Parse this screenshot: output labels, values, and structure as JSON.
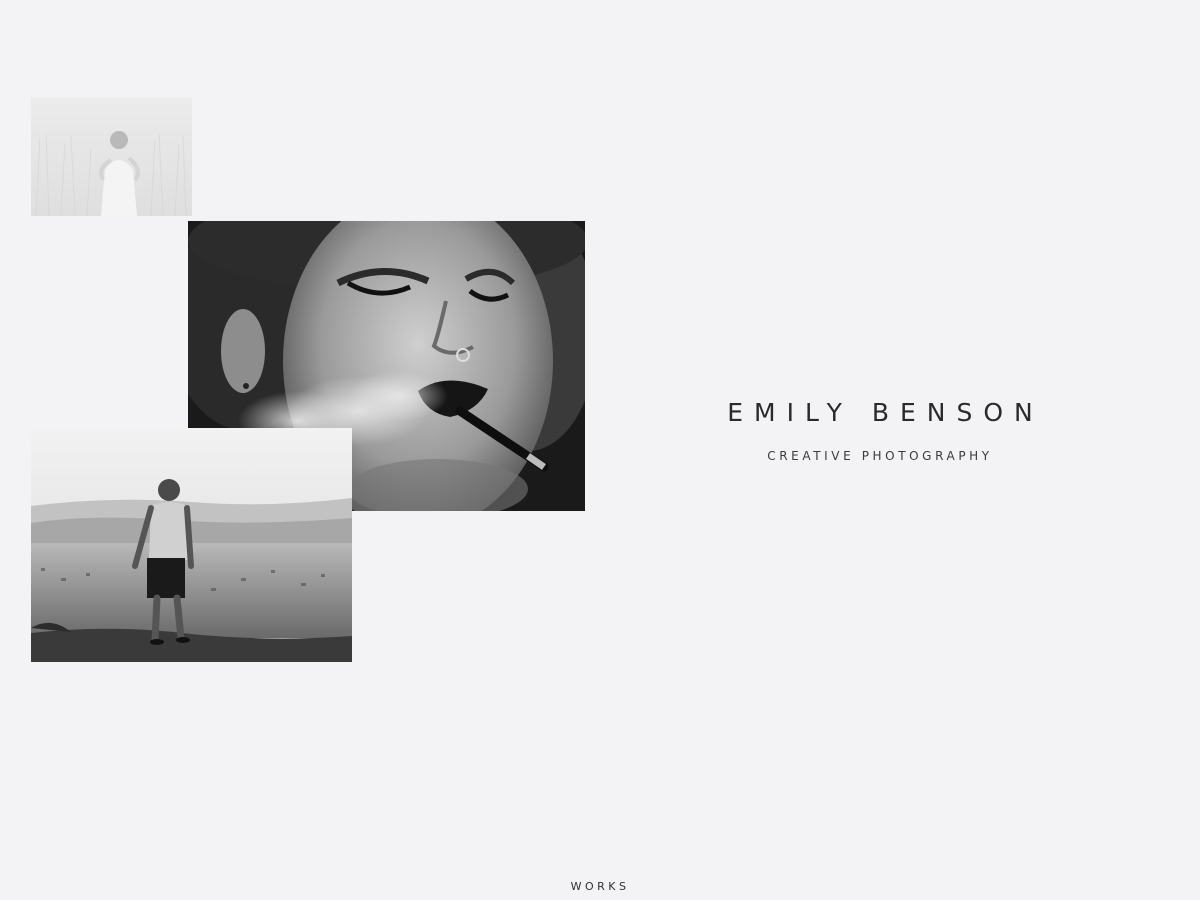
{
  "brand": {
    "name": "EMILY BENSON",
    "tagline": "CREATIVE PHOTOGRAPHY"
  },
  "gallery": {
    "photos": [
      {
        "name": "woman in wheat field"
      },
      {
        "name": "woman with cigarette portrait"
      },
      {
        "name": "boy overlooking landscape"
      }
    ]
  },
  "nav": {
    "works_label": "WORKS"
  },
  "colors": {
    "background": "#f3f3f5",
    "text": "#2a2a2e"
  }
}
